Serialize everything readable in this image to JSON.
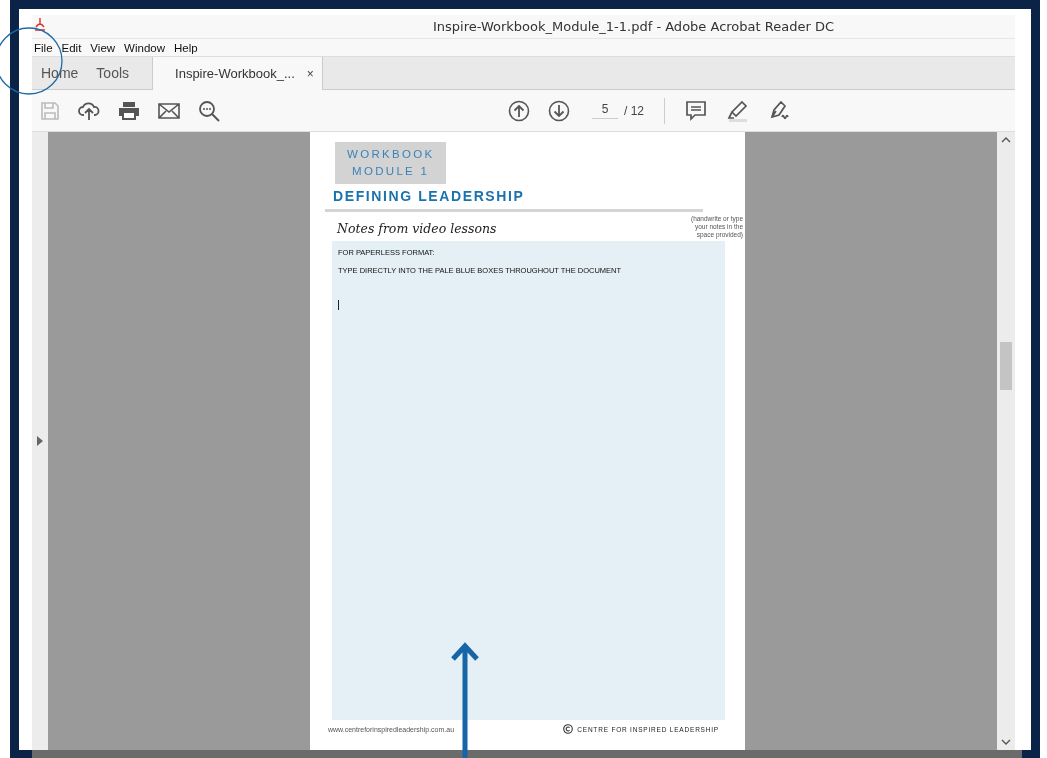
{
  "window": {
    "title": "Inspire-Workbook_Module_1-1.pdf - Adobe Acrobat Reader DC"
  },
  "menu": [
    "File",
    "Edit",
    "View",
    "Window",
    "Help"
  ],
  "tabs": [
    {
      "label": "Home",
      "selected": false,
      "kind": "nav"
    },
    {
      "label": "Tools",
      "selected": false,
      "kind": "nav"
    },
    {
      "label": "Inspire-Workbook_...",
      "selected": true,
      "kind": "document",
      "close": "×"
    }
  ],
  "toolbar": {
    "page": "5",
    "total": "/ 12"
  },
  "document": {
    "badge": [
      "WORKBOOK",
      "MODULE 1"
    ],
    "heading": "DEFINING LEADERSHIP",
    "side_note": [
      "(handwrite or type",
      "your notes in the",
      "space provided)"
    ],
    "notes_title": "Notes from video lessons",
    "box_lines": [
      "FOR PAPERLESS FORMAT:",
      "TYPE DIRECTLY INTO THE PALE BLUE BOXES THROUGHOUT THE DOCUMENT"
    ],
    "footer_url": "www.centreforinspiredleadership.com.au",
    "footer_brand": "CENTRE FOR INSPIRED LEADERSHIP"
  }
}
